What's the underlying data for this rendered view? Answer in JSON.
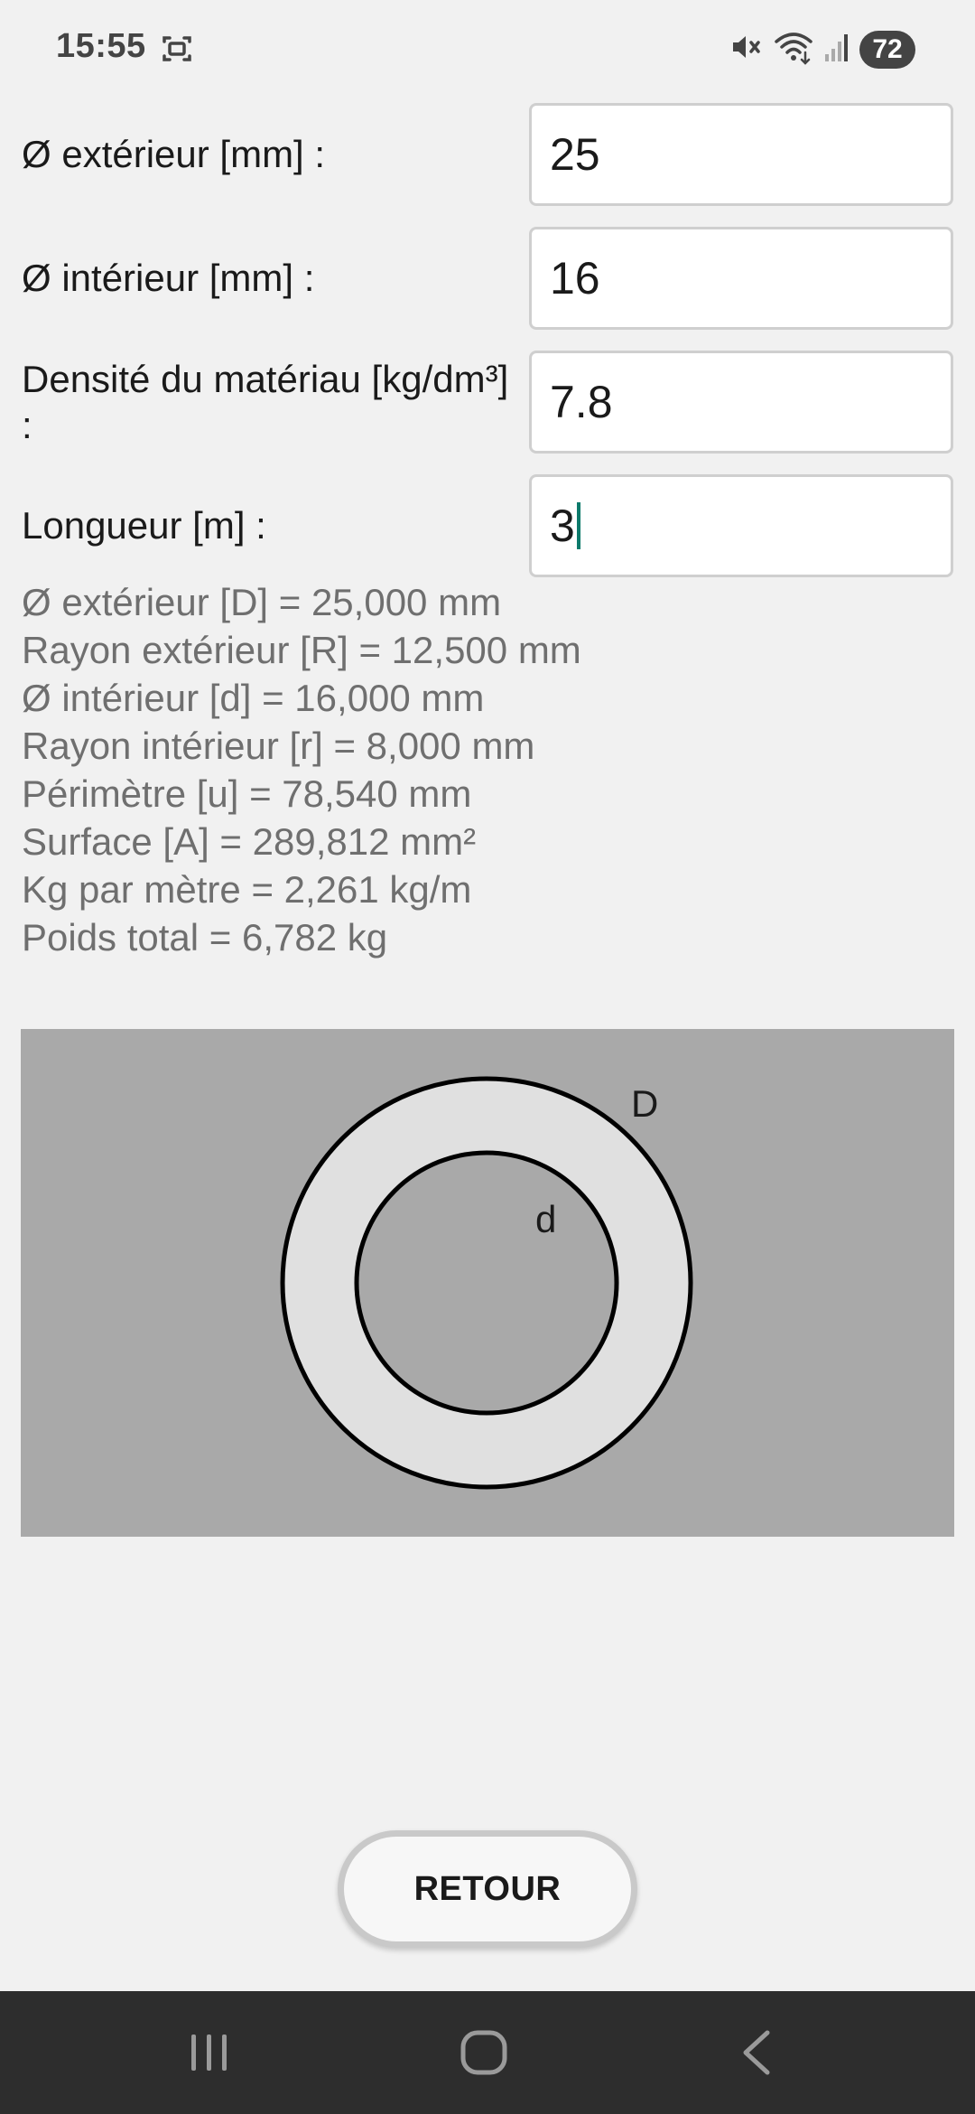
{
  "status_bar": {
    "time": "15:55",
    "battery": "72",
    "icons": [
      "screenshot-icon",
      "mute-icon",
      "wifi-icon",
      "signal-icon"
    ]
  },
  "form": {
    "outer_diameter": {
      "label": "Ø extérieur [mm] :",
      "value": "25"
    },
    "inner_diameter": {
      "label": "Ø intérieur [mm] :",
      "value": "16"
    },
    "density": {
      "label": "Densité du matériau [kg/dm³] :",
      "value": "7.8"
    },
    "length": {
      "label": "Longueur [m] :",
      "value": "3"
    }
  },
  "results": [
    "Ø extérieur [D] = 25,000 mm",
    "Rayon extérieur [R] = 12,500 mm",
    "Ø intérieur [d] = 16,000 mm",
    "Rayon intérieur [r] = 8,000 mm",
    "Périmètre [u] = 78,540 mm",
    "Surface [A] = 289,812 mm²",
    "Kg par mètre = 2,261 kg/m",
    "Poids total = 6,782 kg"
  ],
  "diagram": {
    "outer_label": "D",
    "inner_label": "d",
    "colors": {
      "background": "#a9a9a9",
      "ring": "#e0e0e0",
      "hole": "#a9a9a9",
      "stroke": "#000000"
    }
  },
  "back_button": {
    "label": "RETOUR"
  },
  "nav_bar": {
    "icons": [
      "recent-apps-icon",
      "home-icon",
      "back-icon"
    ]
  }
}
